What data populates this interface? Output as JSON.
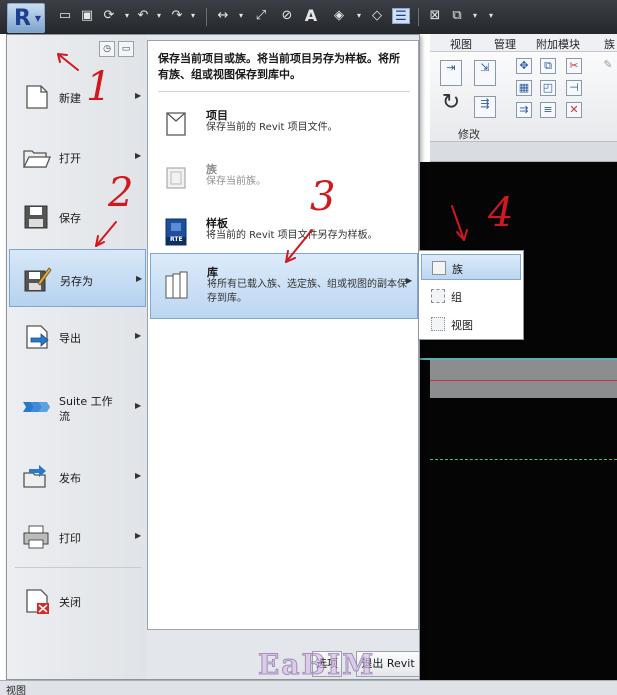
{
  "ribbon": {
    "tabs": [
      "视图",
      "管理",
      "附加模块",
      "族"
    ],
    "panel_label": "修改"
  },
  "app_menu": {
    "left_items": [
      {
        "label": "新建",
        "icon": "new-document-icon",
        "has_submenu": true
      },
      {
        "label": "打开",
        "icon": "open-folder-icon",
        "has_submenu": true
      },
      {
        "label": "保存",
        "icon": "save-disk-icon",
        "has_submenu": false
      },
      {
        "label": "另存为",
        "icon": "save-as-icon",
        "has_submenu": true,
        "active": true
      },
      {
        "label": "导出",
        "icon": "export-icon",
        "has_submenu": true
      },
      {
        "label": "Suite 工作流",
        "icon": "suite-workflow-icon",
        "has_submenu": true
      },
      {
        "label": "发布",
        "icon": "publish-icon",
        "has_submenu": true
      },
      {
        "label": "打印",
        "icon": "printer-icon",
        "has_submenu": true
      },
      {
        "label": "关闭",
        "icon": "close-document-icon",
        "has_submenu": false
      }
    ],
    "submenu": {
      "header": "保存当前项目或族。将当前项目另存为样板。将所有族、组或视图保存到库中。",
      "items": [
        {
          "title": "项目",
          "desc": "保存当前的 Revit 项目文件。",
          "icon": "project-icon"
        },
        {
          "title": "族",
          "desc": "保存当前族。",
          "icon": "family-icon",
          "disabled": true
        },
        {
          "title": "样板",
          "desc": "将当前的 Revit 项目文件另存为样板。",
          "icon": "template-icon",
          "icon_text": "RTE"
        },
        {
          "title": "库",
          "desc": "将所有已载入族、选定族、组或视图的副本保存到库。",
          "icon": "library-icon",
          "active": true
        }
      ]
    },
    "options_label": "选项",
    "exit_label": "退出 Revit"
  },
  "flyout": {
    "items": [
      {
        "label": "族",
        "icon": "family-small-icon"
      },
      {
        "label": "组",
        "icon": "group-small-icon"
      },
      {
        "label": "视图",
        "icon": "view-small-icon"
      }
    ]
  },
  "annotations": [
    "1",
    "2",
    "3",
    "4"
  ],
  "status_text": "视图",
  "watermark": "EaBIM",
  "colors": {
    "annotation_red": "#d0181e",
    "highlight_blue": "#bcd6f1",
    "toolbar_dark": "#2e3136"
  }
}
